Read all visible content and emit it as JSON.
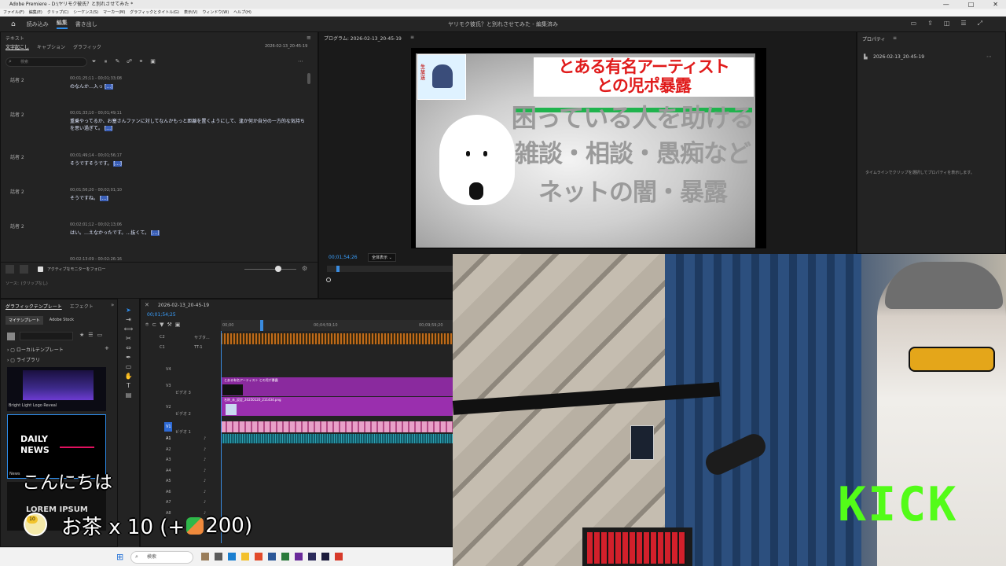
{
  "window": {
    "title": "Adobe Premiere - D:\\ヤリモク彼氏？と別れさせてみた *",
    "controls": [
      "—",
      "□",
      "✕"
    ]
  },
  "menubar": [
    "ファイル(F)",
    "編集(E)",
    "クリップ(C)",
    "シーケンス(S)",
    "マーカー(M)",
    "グラフィックとタイトル(G)",
    "表示(V)",
    "ウィンドウ(W)",
    "ヘルプ(H)"
  ],
  "header": {
    "tabs": [
      "読み込み",
      "編集",
      "書き出し"
    ],
    "active_tab": "編集",
    "project_title": "ヤリモク彼氏？と別れさせてみた - 編集済み"
  },
  "text_panel": {
    "title": "テキスト",
    "tabs": [
      "文字起こし",
      "キャプション",
      "グラフィック"
    ],
    "sequence": "2026-02-13_20-45-19",
    "search_placeholder": "検索",
    "rows": [
      {
        "speaker": "話者 2",
        "time": "00;01;25;11 - 00;01;33;08",
        "text": "のなんか…入っ",
        "tail": "[…]"
      },
      {
        "speaker": "話者 2",
        "time": "00;01;33;10 - 00;01;49;11",
        "text": "重乗やってるか、お塞さんファンに対してなんかもっと距離を置くようにして、逢か何か自分の一方的な気持ちを思い過ぎて。",
        "tail": "[…]"
      },
      {
        "speaker": "話者 2",
        "time": "00;01;49;14 - 00;01;56;17",
        "text": "そうですそうです。",
        "tail": "[…]"
      },
      {
        "speaker": "話者 2",
        "time": "00;01;56;20 - 00;02;01;10",
        "text": "そうですね。",
        "tail": "[…]"
      },
      {
        "speaker": "話者 2",
        "time": "00;02;01;12 - 00;02;13;06",
        "text": "はい。…えなかったです。…抜くて。",
        "tail": "[…]"
      },
      {
        "speaker": "",
        "time": "00;02;13;09 - 00;02;26;16",
        "text": "",
        "tail": ""
      }
    ],
    "follow_label": "アクティブなモニターをフォロー",
    "source_label": "ソース：(クリップなし)"
  },
  "program": {
    "title": "プログラム: 2026-02-13_20-45-19",
    "timecode": "00;01;54;26",
    "fit": "全体表示",
    "thumb_text": "生放送",
    "overlay_top": [
      "とある有名アーティスト",
      "との児ポ暴露"
    ],
    "overlay_lines": [
      "困っている人を助ける",
      "雑談・相談・愚痴など",
      "ネットの闇・暴露"
    ]
  },
  "properties": {
    "title": "プロパティ",
    "sequence": "2026-02-13_20-45-19",
    "hint": "タイムラインでクリップを選択してプロパティを表示します。"
  },
  "graphics_panel": {
    "tabs": [
      "グラフィックテンプレート",
      "エフェクト"
    ],
    "sub_tabs": [
      "マイテンプレート",
      "Adobe Stock"
    ],
    "tree": [
      "ローカルテンプレート",
      "ライブラリ"
    ],
    "templates": [
      {
        "name": "Bright Light Logo Reveal",
        "label": ""
      },
      {
        "name": "News",
        "label": "DAILY NEWS"
      },
      {
        "name": "",
        "label": "LOREM IPSUM"
      }
    ]
  },
  "timeline": {
    "sequence": "2026-02-13_20-45-19",
    "timecode": "00;01;54;25",
    "ruler": [
      "00;00",
      "00;04;59;10",
      "00;09;59;20"
    ],
    "tracks_top": [
      {
        "id": "C2",
        "name": "サブタ..."
      },
      {
        "id": "C1",
        "name": "TT-1"
      }
    ],
    "video_tracks": [
      {
        "id": "V4",
        "name": ""
      },
      {
        "id": "V3",
        "name": "ビデオ 3"
      },
      {
        "id": "V2",
        "name": "ビデオ 2"
      },
      {
        "id": "V1",
        "name": "ビデオ 1"
      }
    ],
    "audio_tracks": [
      "A1",
      "A2",
      "A3",
      "A4",
      "A5",
      "A6",
      "A7",
      "A8"
    ],
    "clips": {
      "v3": "とある有名アーティスト との児ポ暴露",
      "v2": "名称_未_設定_20250120_211434.png"
    }
  },
  "stream_overlay": {
    "chat_greeting": "こんにちは",
    "gift_text": "お茶 x 10 (+",
    "gift_amount": "200)",
    "gift_badge": "10",
    "brand": "KICK",
    "brand_color": "#53fc18"
  },
  "taskbar": {
    "search": "検索"
  }
}
